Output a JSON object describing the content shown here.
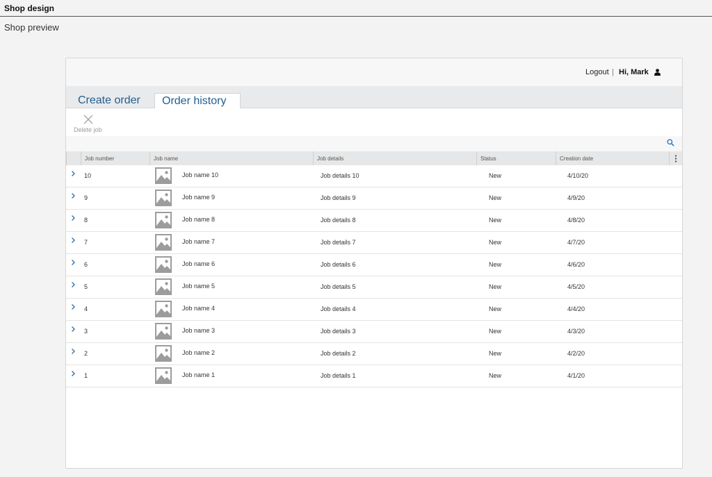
{
  "app": {
    "title": "Shop design",
    "subtitle": "Shop preview"
  },
  "header": {
    "logout_label": "Logout",
    "separator": "|",
    "greeting": "Hi, Mark",
    "user_icon": "user-icon"
  },
  "tabs": [
    {
      "label": "Create order",
      "active": false
    },
    {
      "label": "Order history",
      "active": true
    }
  ],
  "toolbar": {
    "delete_label": "Delete job",
    "delete_icon": "close-icon"
  },
  "search": {
    "icon": "search-icon"
  },
  "colors": {
    "accent": "#1f5e93",
    "header_bg": "#e6e7e8",
    "tabbar_bg": "#e9eaeb"
  },
  "table": {
    "columns": [
      "Job number",
      "Job name",
      "Job details",
      "Status",
      "Creation date"
    ],
    "rows": [
      {
        "number": "10",
        "name": "Job name 10",
        "details": "Job details 10",
        "status": "New",
        "date": "4/10/20"
      },
      {
        "number": "9",
        "name": "Job name 9",
        "details": "Job details 9",
        "status": "New",
        "date": "4/9/20"
      },
      {
        "number": "8",
        "name": "Job name 8",
        "details": "Job details 8",
        "status": "New",
        "date": "4/8/20"
      },
      {
        "number": "7",
        "name": "Job name 7",
        "details": "Job details 7",
        "status": "New",
        "date": "4/7/20"
      },
      {
        "number": "6",
        "name": "Job name 6",
        "details": "Job details 6",
        "status": "New",
        "date": "4/6/20"
      },
      {
        "number": "5",
        "name": "Job name 5",
        "details": "Job details 5",
        "status": "New",
        "date": "4/5/20"
      },
      {
        "number": "4",
        "name": "Job name 4",
        "details": "Job details 4",
        "status": "New",
        "date": "4/4/20"
      },
      {
        "number": "3",
        "name": "Job name 3",
        "details": "Job details 3",
        "status": "New",
        "date": "4/3/20"
      },
      {
        "number": "2",
        "name": "Job name 2",
        "details": "Job details 2",
        "status": "New",
        "date": "4/2/20"
      },
      {
        "number": "1",
        "name": "Job name 1",
        "details": "Job details 1",
        "status": "New",
        "date": "4/1/20"
      }
    ]
  }
}
